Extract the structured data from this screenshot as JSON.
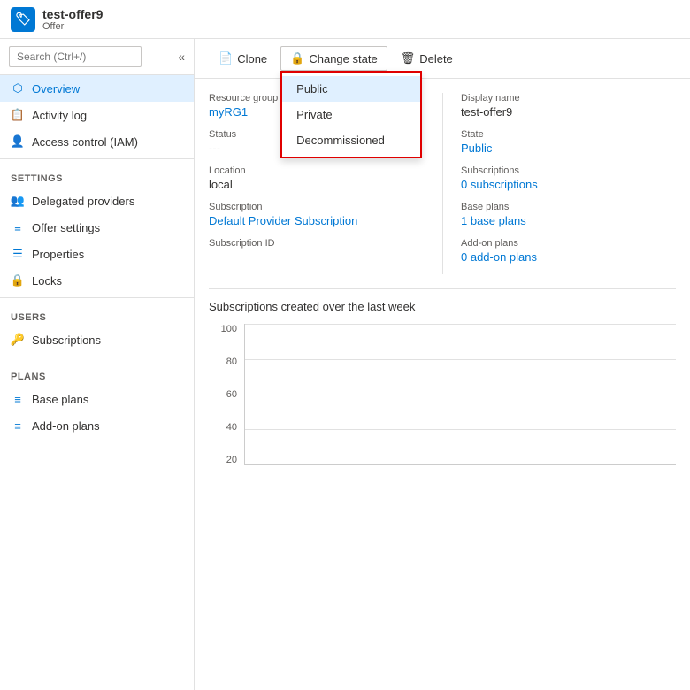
{
  "app": {
    "icon": "🏷",
    "title": "test-offer9",
    "subtitle": "Offer"
  },
  "sidebar": {
    "search_placeholder": "Search (Ctrl+/)",
    "nav_items": [
      {
        "id": "overview",
        "label": "Overview",
        "icon": "⬡",
        "active": true
      },
      {
        "id": "activity-log",
        "label": "Activity log",
        "icon": "📋",
        "active": false
      },
      {
        "id": "access-control",
        "label": "Access control (IAM)",
        "icon": "👤",
        "active": false
      }
    ],
    "settings_label": "Settings",
    "settings_items": [
      {
        "id": "delegated-providers",
        "label": "Delegated providers",
        "icon": "👥"
      },
      {
        "id": "offer-settings",
        "label": "Offer settings",
        "icon": "≡"
      },
      {
        "id": "properties",
        "label": "Properties",
        "icon": "☰"
      },
      {
        "id": "locks",
        "label": "Locks",
        "icon": "🔒"
      }
    ],
    "users_label": "Users",
    "users_items": [
      {
        "id": "subscriptions",
        "label": "Subscriptions",
        "icon": "🔑"
      }
    ],
    "plans_label": "Plans",
    "plans_items": [
      {
        "id": "base-plans",
        "label": "Base plans",
        "icon": "≡"
      },
      {
        "id": "add-on-plans",
        "label": "Add-on plans",
        "icon": "≡"
      }
    ]
  },
  "toolbar": {
    "clone_label": "Clone",
    "change_state_label": "Change state",
    "delete_label": "Delete"
  },
  "dropdown": {
    "items": [
      {
        "id": "public",
        "label": "Public",
        "selected": true
      },
      {
        "id": "private",
        "label": "Private",
        "selected": false
      },
      {
        "id": "decommissioned",
        "label": "Decommissioned",
        "selected": false
      }
    ]
  },
  "details": {
    "resource_group_label": "Resource group",
    "resource_group_value": "myRG1",
    "status_label": "Status",
    "status_value": "---",
    "location_label": "Location",
    "location_value": "local",
    "subscription_label": "Subscription",
    "subscription_value": "Default Provider Subscription",
    "subscription_id_label": "Subscription ID",
    "display_name_label": "Display name",
    "display_name_value": "test-offer9",
    "state_label": "State",
    "state_value": "Public",
    "subscriptions_label": "Subscriptions",
    "subscriptions_value": "0 subscriptions",
    "base_plans_label": "Base plans",
    "base_plans_value": "1 base plans",
    "add_on_plans_label": "Add-on plans",
    "add_on_plans_value": "0 add-on plans"
  },
  "chart": {
    "title": "Subscriptions created over the last week",
    "y_labels": [
      "100",
      "80",
      "60",
      "40",
      "20"
    ],
    "collapse_icon": "∧"
  }
}
